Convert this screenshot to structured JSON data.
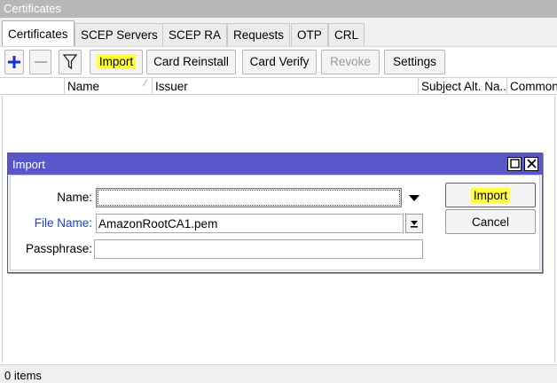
{
  "window": {
    "title": "Certificates"
  },
  "tabs": [
    {
      "label": "Certificates",
      "active": true
    },
    {
      "label": "SCEP Servers"
    },
    {
      "label": "SCEP RA"
    },
    {
      "label": "Requests"
    },
    {
      "label": "OTP"
    },
    {
      "label": "CRL"
    }
  ],
  "toolbar": {
    "add_icon": "plus-icon",
    "remove_icon": "minus-icon",
    "filter_icon": "filter-icon",
    "import_label": "Import",
    "card_reinstall_label": "Card Reinstall",
    "card_verify_label": "Card Verify",
    "revoke_label": "Revoke",
    "settings_label": "Settings"
  },
  "table": {
    "columns": [
      "Name",
      "Issuer",
      "Subject Alt. Na...",
      "Common"
    ],
    "rows": []
  },
  "status": {
    "items_text": "0 items"
  },
  "dialog": {
    "title": "Import",
    "name_label": "Name:",
    "name_value": "",
    "file_name_label": "File Name:",
    "file_name_value": "AmazonRootCA1.pem",
    "passphrase_label": "Passphrase:",
    "passphrase_value": "",
    "import_button": "Import",
    "cancel_button": "Cancel",
    "maximize_icon": "maximize-icon",
    "close_icon": "close-icon"
  },
  "colors": {
    "highlight": "#ffff3c",
    "dialog_title_bg": "#5757c9",
    "link_label": "#1a3fd6",
    "window_title_bg": "#b8b8b8"
  }
}
